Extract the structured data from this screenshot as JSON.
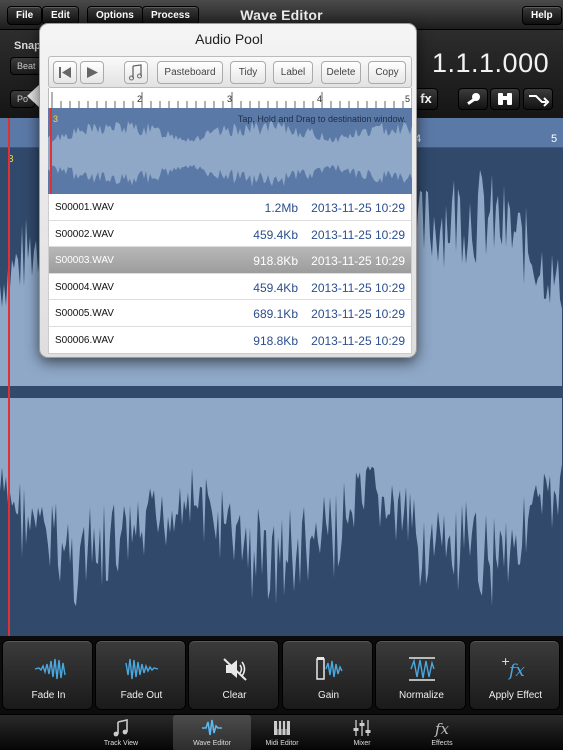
{
  "menu": {
    "file": "File",
    "edit": "Edit",
    "options": "Options",
    "process": "Process",
    "help": "Help"
  },
  "app_title": "Wave Editor",
  "control_strip": {
    "snap_label": "Snap",
    "beat_button": "Beat",
    "pos_button": "Po",
    "position": "1.1.1.000",
    "fx_button": "fx"
  },
  "ruler": {
    "track_marker": "3",
    "labels": [
      "4",
      "5"
    ]
  },
  "audio_pool": {
    "title": "Audio Pool",
    "buttons": {
      "pasteboard": "Pasteboard",
      "tidy": "Tidy",
      "label": "Label",
      "delete": "Delete",
      "copy": "Copy"
    },
    "ruler_labels": [
      "2",
      "3",
      "4",
      "5"
    ],
    "track_marker": "3",
    "hint": "Tap, Hold and Drag to destination window.",
    "files": [
      {
        "name": "S00001.WAV",
        "size": "1.2Mb",
        "date": "2013-11-25 10:29",
        "selected": false
      },
      {
        "name": "S00002.WAV",
        "size": "459.4Kb",
        "date": "2013-11-25 10:29",
        "selected": false
      },
      {
        "name": "S00003.WAV",
        "size": "918.8Kb",
        "date": "2013-11-25 10:29",
        "selected": true
      },
      {
        "name": "S00004.WAV",
        "size": "459.4Kb",
        "date": "2013-11-25 10:29",
        "selected": false
      },
      {
        "name": "S00005.WAV",
        "size": "689.1Kb",
        "date": "2013-11-25 10:29",
        "selected": false
      },
      {
        "name": "S00006.WAV",
        "size": "918.8Kb",
        "date": "2013-11-25 10:29",
        "selected": false
      }
    ]
  },
  "tools": [
    {
      "label": "Fade In",
      "icon": "fade-in-icon"
    },
    {
      "label": "Fade Out",
      "icon": "fade-out-icon"
    },
    {
      "label": "Clear",
      "icon": "mute-speaker-icon"
    },
    {
      "label": "Gain",
      "icon": "gain-icon"
    },
    {
      "label": "Normalize",
      "icon": "normalize-icon"
    },
    {
      "label": "Apply Effect",
      "icon": "fx-icon"
    }
  ],
  "tabs": [
    {
      "label": "Track View",
      "icon": "music-note-icon",
      "active": false
    },
    {
      "label": "Wave Editor",
      "icon": "waveform-icon",
      "active": true
    },
    {
      "label": "Midi Editor",
      "icon": "piano-keys-icon",
      "active": false
    },
    {
      "label": "Mixer",
      "icon": "mixer-sliders-icon",
      "active": false
    },
    {
      "label": "Effects",
      "icon": "fx-icon",
      "active": false
    }
  ],
  "colors": {
    "wave_bg": "#31496b",
    "wave_fill": "#8fa8c8",
    "playhead": "#dd3333",
    "accent_text": "#2b4f8e",
    "marker": "#f5d34b"
  }
}
